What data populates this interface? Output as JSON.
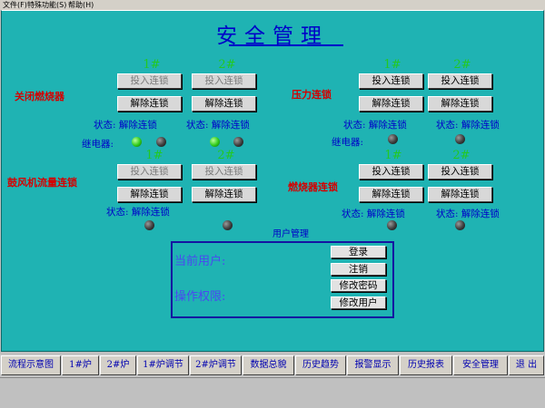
{
  "menu": {
    "file": "文件(F)",
    "special": "特殊功能(S)",
    "help": "帮助(H)"
  },
  "title": "安全管理",
  "labels": {
    "burner_off": "关闭燃烧器",
    "pressure": "压力连锁",
    "fan_flow": "鼓风机流量连锁",
    "burner_interlock": "燃烧器连锁"
  },
  "unit_1": "1#",
  "unit_2": "2#",
  "buttons": {
    "engage": "投入连锁",
    "release": "解除连锁"
  },
  "status_text": "状态: 解除连锁",
  "relay_text": "继电器:",
  "lamps": {
    "burner_1_a": "on",
    "burner_1_b": "off",
    "burner_2_a": "on",
    "burner_2_b": "off",
    "pressure_1": "off",
    "pressure_2": "off",
    "fan_1": "off",
    "fan_2": "off",
    "interlock_1": "off",
    "interlock_2": "off"
  },
  "user": {
    "caption": "用户管理",
    "current_user": "当前用户:",
    "permission": "操作权限:",
    "login": "登录",
    "logout": "注销",
    "change_password": "修改密码",
    "modify_user": "修改用户"
  },
  "nav": [
    "流程示意图",
    "1#炉",
    "2#炉",
    "1#炉调节",
    "2#炉调节",
    "数据总貌",
    "历史趋势",
    "报警显示",
    "历史报表",
    "安全管理",
    "退 出"
  ],
  "colors": {
    "background": "#1fb3b3",
    "title": "#0000c8",
    "label_red": "#d40000",
    "unit_green": "#22c822"
  }
}
